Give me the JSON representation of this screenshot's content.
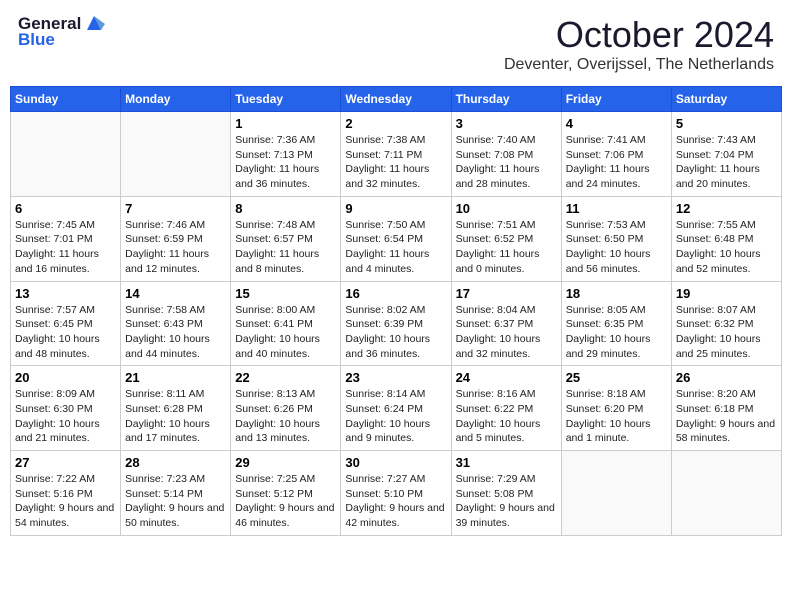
{
  "header": {
    "logo_text_general": "General",
    "logo_text_blue": "Blue",
    "month_title": "October 2024",
    "location": "Deventer, Overijssel, The Netherlands"
  },
  "weekdays": [
    "Sunday",
    "Monday",
    "Tuesday",
    "Wednesday",
    "Thursday",
    "Friday",
    "Saturday"
  ],
  "weeks": [
    [
      {
        "day": "",
        "sunrise": "",
        "sunset": "",
        "daylight": ""
      },
      {
        "day": "",
        "sunrise": "",
        "sunset": "",
        "daylight": ""
      },
      {
        "day": "1",
        "sunrise": "Sunrise: 7:36 AM",
        "sunset": "Sunset: 7:13 PM",
        "daylight": "Daylight: 11 hours and 36 minutes."
      },
      {
        "day": "2",
        "sunrise": "Sunrise: 7:38 AM",
        "sunset": "Sunset: 7:11 PM",
        "daylight": "Daylight: 11 hours and 32 minutes."
      },
      {
        "day": "3",
        "sunrise": "Sunrise: 7:40 AM",
        "sunset": "Sunset: 7:08 PM",
        "daylight": "Daylight: 11 hours and 28 minutes."
      },
      {
        "day": "4",
        "sunrise": "Sunrise: 7:41 AM",
        "sunset": "Sunset: 7:06 PM",
        "daylight": "Daylight: 11 hours and 24 minutes."
      },
      {
        "day": "5",
        "sunrise": "Sunrise: 7:43 AM",
        "sunset": "Sunset: 7:04 PM",
        "daylight": "Daylight: 11 hours and 20 minutes."
      }
    ],
    [
      {
        "day": "6",
        "sunrise": "Sunrise: 7:45 AM",
        "sunset": "Sunset: 7:01 PM",
        "daylight": "Daylight: 11 hours and 16 minutes."
      },
      {
        "day": "7",
        "sunrise": "Sunrise: 7:46 AM",
        "sunset": "Sunset: 6:59 PM",
        "daylight": "Daylight: 11 hours and 12 minutes."
      },
      {
        "day": "8",
        "sunrise": "Sunrise: 7:48 AM",
        "sunset": "Sunset: 6:57 PM",
        "daylight": "Daylight: 11 hours and 8 minutes."
      },
      {
        "day": "9",
        "sunrise": "Sunrise: 7:50 AM",
        "sunset": "Sunset: 6:54 PM",
        "daylight": "Daylight: 11 hours and 4 minutes."
      },
      {
        "day": "10",
        "sunrise": "Sunrise: 7:51 AM",
        "sunset": "Sunset: 6:52 PM",
        "daylight": "Daylight: 11 hours and 0 minutes."
      },
      {
        "day": "11",
        "sunrise": "Sunrise: 7:53 AM",
        "sunset": "Sunset: 6:50 PM",
        "daylight": "Daylight: 10 hours and 56 minutes."
      },
      {
        "day": "12",
        "sunrise": "Sunrise: 7:55 AM",
        "sunset": "Sunset: 6:48 PM",
        "daylight": "Daylight: 10 hours and 52 minutes."
      }
    ],
    [
      {
        "day": "13",
        "sunrise": "Sunrise: 7:57 AM",
        "sunset": "Sunset: 6:45 PM",
        "daylight": "Daylight: 10 hours and 48 minutes."
      },
      {
        "day": "14",
        "sunrise": "Sunrise: 7:58 AM",
        "sunset": "Sunset: 6:43 PM",
        "daylight": "Daylight: 10 hours and 44 minutes."
      },
      {
        "day": "15",
        "sunrise": "Sunrise: 8:00 AM",
        "sunset": "Sunset: 6:41 PM",
        "daylight": "Daylight: 10 hours and 40 minutes."
      },
      {
        "day": "16",
        "sunrise": "Sunrise: 8:02 AM",
        "sunset": "Sunset: 6:39 PM",
        "daylight": "Daylight: 10 hours and 36 minutes."
      },
      {
        "day": "17",
        "sunrise": "Sunrise: 8:04 AM",
        "sunset": "Sunset: 6:37 PM",
        "daylight": "Daylight: 10 hours and 32 minutes."
      },
      {
        "day": "18",
        "sunrise": "Sunrise: 8:05 AM",
        "sunset": "Sunset: 6:35 PM",
        "daylight": "Daylight: 10 hours and 29 minutes."
      },
      {
        "day": "19",
        "sunrise": "Sunrise: 8:07 AM",
        "sunset": "Sunset: 6:32 PM",
        "daylight": "Daylight: 10 hours and 25 minutes."
      }
    ],
    [
      {
        "day": "20",
        "sunrise": "Sunrise: 8:09 AM",
        "sunset": "Sunset: 6:30 PM",
        "daylight": "Daylight: 10 hours and 21 minutes."
      },
      {
        "day": "21",
        "sunrise": "Sunrise: 8:11 AM",
        "sunset": "Sunset: 6:28 PM",
        "daylight": "Daylight: 10 hours and 17 minutes."
      },
      {
        "day": "22",
        "sunrise": "Sunrise: 8:13 AM",
        "sunset": "Sunset: 6:26 PM",
        "daylight": "Daylight: 10 hours and 13 minutes."
      },
      {
        "day": "23",
        "sunrise": "Sunrise: 8:14 AM",
        "sunset": "Sunset: 6:24 PM",
        "daylight": "Daylight: 10 hours and 9 minutes."
      },
      {
        "day": "24",
        "sunrise": "Sunrise: 8:16 AM",
        "sunset": "Sunset: 6:22 PM",
        "daylight": "Daylight: 10 hours and 5 minutes."
      },
      {
        "day": "25",
        "sunrise": "Sunrise: 8:18 AM",
        "sunset": "Sunset: 6:20 PM",
        "daylight": "Daylight: 10 hours and 1 minute."
      },
      {
        "day": "26",
        "sunrise": "Sunrise: 8:20 AM",
        "sunset": "Sunset: 6:18 PM",
        "daylight": "Daylight: 9 hours and 58 minutes."
      }
    ],
    [
      {
        "day": "27",
        "sunrise": "Sunrise: 7:22 AM",
        "sunset": "Sunset: 5:16 PM",
        "daylight": "Daylight: 9 hours and 54 minutes."
      },
      {
        "day": "28",
        "sunrise": "Sunrise: 7:23 AM",
        "sunset": "Sunset: 5:14 PM",
        "daylight": "Daylight: 9 hours and 50 minutes."
      },
      {
        "day": "29",
        "sunrise": "Sunrise: 7:25 AM",
        "sunset": "Sunset: 5:12 PM",
        "daylight": "Daylight: 9 hours and 46 minutes."
      },
      {
        "day": "30",
        "sunrise": "Sunrise: 7:27 AM",
        "sunset": "Sunset: 5:10 PM",
        "daylight": "Daylight: 9 hours and 42 minutes."
      },
      {
        "day": "31",
        "sunrise": "Sunrise: 7:29 AM",
        "sunset": "Sunset: 5:08 PM",
        "daylight": "Daylight: 9 hours and 39 minutes."
      },
      {
        "day": "",
        "sunrise": "",
        "sunset": "",
        "daylight": ""
      },
      {
        "day": "",
        "sunrise": "",
        "sunset": "",
        "daylight": ""
      }
    ]
  ]
}
